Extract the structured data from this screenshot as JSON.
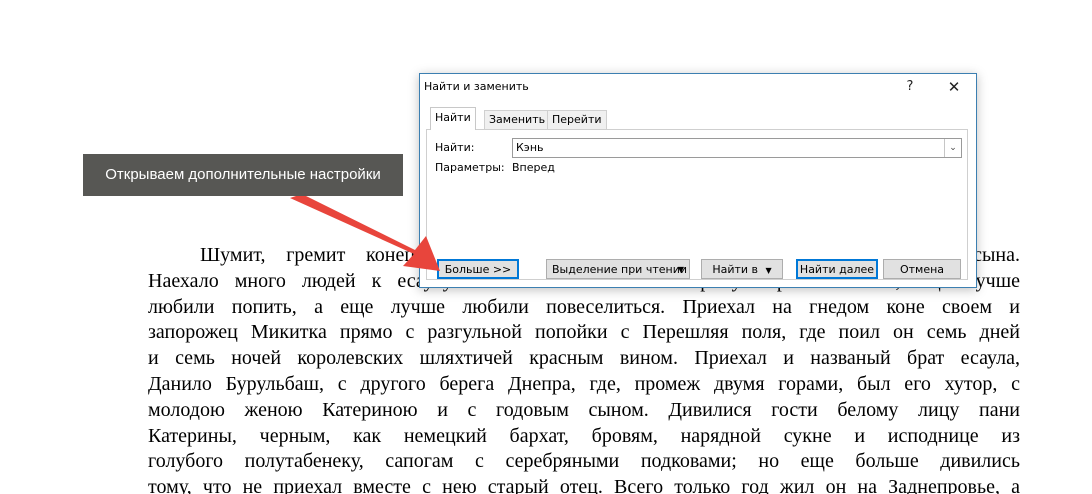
{
  "document": {
    "lines": [
      "Шумит, гремит конец Киевского, есаул Горобец празднует свадьбу своего сына.",
      "Наехало много людей к есаулу в гости. Любили в старину хорошо поесть, еще лучше",
      "любили попить, а еще лучше любили повеселиться. Приехал на гнедом коне своем и",
      "запорожец Микитка прямо с разгульной попойки с Перешляя поля, где поил он семь дней",
      "и семь ночей королевских шляхтичей красным вином. Приехал и названый брат есаула,",
      "Данило Бурульбаш, с другого берега Днепра, где, промеж двумя горами, был его хутор, с",
      "молодою женою Катериною и с годовым сыном. Дивилися гости белому лицу пани",
      "Катерины, черным, как немецкий бархат, бровям, нарядной сукне и исподнице из",
      "голубого полутабенеку, сапогам с серебряными подковами; но еще больше дивились",
      "тому, что не приехал вместе с нею старый отец. Всего только год жил он на Заднепровье, а"
    ]
  },
  "dialog": {
    "title": "Найти и заменить",
    "help_label": "?",
    "close_label": "✕",
    "tabs": [
      {
        "label": "Найти",
        "active": true
      },
      {
        "label": "Заменить",
        "active": false
      },
      {
        "label": "Перейти",
        "active": false
      }
    ],
    "find_label": "Найти:",
    "find_value": "Кэнь",
    "params_label": "Параметры:",
    "params_value": "Вперед",
    "buttons": {
      "more": "Больше >>",
      "reading_highlight": "Выделение при чтении",
      "find_in": "Найти в",
      "find_next": "Найти далее",
      "cancel": "Отмена"
    }
  },
  "callout": {
    "text": "Открываем  дополнительные настройки",
    "color": "#575754",
    "arrow_color": "#e8453c"
  }
}
